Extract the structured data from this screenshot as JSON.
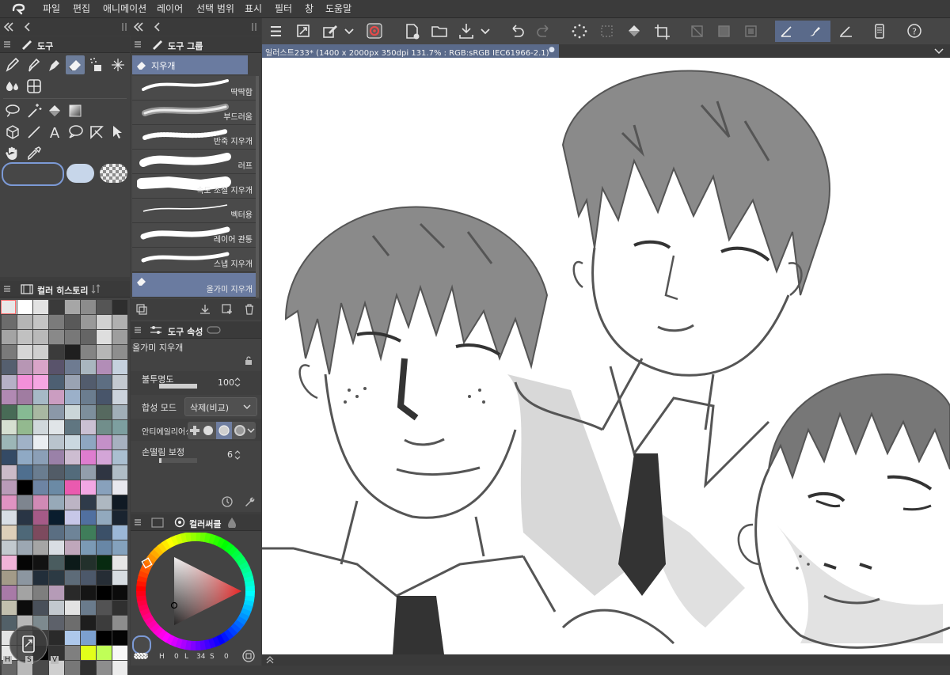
{
  "menubar": {
    "items": [
      "파일",
      "편집",
      "애니메이션",
      "레이어",
      "선택 범위",
      "표시",
      "필터",
      "창",
      "도움말"
    ]
  },
  "canvas_tab": {
    "title": "일러스트233* (1400 x 2000px 350dpi 131.7% : RGB:sRGB IEC61966-2.1)",
    "bullet": "●"
  },
  "tool_panel": {
    "title": "도구"
  },
  "subtool_panel": {
    "title": "도구 그룹",
    "group_name": "지우개",
    "items": [
      "딱딱함",
      "부드러움",
      "반죽 지우개",
      "러프",
      "속도 조절 지우개",
      "벡터용",
      "레이어 관통",
      "스냅 지우개",
      "올가미 지우개"
    ]
  },
  "color_history": {
    "title": "컬러 히스토리"
  },
  "tool_property": {
    "title": "도구 속성",
    "tool_name": "올가미 지우개",
    "opacity_label": "불투명도",
    "opacity_value": "100",
    "opacity_fraction": 1.0,
    "blend_label": "합성 모드",
    "blend_value": "삭제(비교)",
    "aa_label": "안티에일리어싱",
    "stab_label": "손떨림 보정",
    "stab_value": "6",
    "stab_fraction": 0.06
  },
  "color_wheel": {
    "title": "컬러써클",
    "h_label": "H",
    "h_value": "0",
    "l_label": "L",
    "l_value": "34",
    "s_label": "S",
    "s_value": "0"
  },
  "hsv_labels": [
    "H",
    "S",
    "V"
  ],
  "colors": {
    "accent": "#6a7ba0",
    "panel_bg": "#434343",
    "canvas_bg": "#ffffff",
    "line_art": "#555555",
    "hair": "#8a8a8a",
    "shadow": "#d8d8d8"
  },
  "palette": [
    "#e7e7e7",
    "#ffffff",
    "#e2e2e2",
    "#3a3a3a",
    "#a6a6a6",
    "#8c8c8c",
    "#555555",
    "#2e2e2e",
    "#6c6c6c",
    "#b5b5b5",
    "#c4c4c4",
    "#7b7b7b",
    "#595959",
    "#999999",
    "#d1d1d1",
    "#b0b0b0",
    "#a4a4a4",
    "#c1c1c1",
    "#b9b9b9",
    "#898989",
    "#787878",
    "#656565",
    "#dedede",
    "#9e9e9e",
    "#7a7a7a",
    "#d6d6d6",
    "#cfcfcf",
    "#3b3b3b",
    "#1f1f1f",
    "#848484",
    "#b6b6b6",
    "#8e8e8e",
    "#555f6f",
    "#b796b4",
    "#d9a4c8",
    "#59536b",
    "#6e7b91",
    "#a9b6bf",
    "#b28db7",
    "#c5d1de",
    "#b6b0c6",
    "#f390d9",
    "#f6a6e2",
    "#4d5f72",
    "#9aa3b3",
    "#525c6d",
    "#5d6e82",
    "#c3c9d0",
    "#b189b3",
    "#a07ca1",
    "#a6b9c6",
    "#cb9dc1",
    "#9bb0c9",
    "#6b7d8f",
    "#48556a",
    "#cbd3dc",
    "#486b56",
    "#86ba93",
    "#a8b8a2",
    "#8b98a8",
    "#cbd6d8",
    "#7d8f9c",
    "#56695f",
    "#a1afb8",
    "#d5dfd1",
    "#93b98f",
    "#d0d8dc",
    "#e0e5e8",
    "#607681",
    "#cac0d3",
    "#718e8b",
    "#7d9fa0",
    "#9cb6b7",
    "#a0b2c7",
    "#eaeef2",
    "#b9c4cd",
    "#cad8e0",
    "#8ea6c1",
    "#c490c8",
    "#a7b1c0",
    "#344a65",
    "#8fa9c4",
    "#8b9fb7",
    "#9a81a8",
    "#cdbdd1",
    "#de7dcf",
    "#d3a5d7",
    "#aabfd0",
    "#cbbbc8",
    "#4f6f8f",
    "#6a7d90",
    "#525c67",
    "#536b7b",
    "#929eab",
    "#2f3542",
    "#b0bdc6",
    "#b99bb8",
    "#000000",
    "#6d84a4",
    "#6b8aa5",
    "#ea5aaf",
    "#f2a7e4",
    "#88a1bc",
    "#e8e8ee",
    "#e093c2",
    "#7e858f",
    "#d08ab5",
    "#97a9b8",
    "#bcb4c4",
    "#2f3b4a",
    "#aeb8c1",
    "#101a24",
    "#d8dee5",
    "#293545",
    "#a55a87",
    "#0a1d2e",
    "#c7c7e8",
    "#5170a0",
    "#92a9be",
    "#1a2430",
    "#ddcfb9",
    "#4e6878",
    "#7d4a5e",
    "#5a6e82",
    "#6e8498",
    "#3f7d5a",
    "#3b5068",
    "#9bb7d7",
    "#c2c9ce",
    "#9ca7b2",
    "#a5a5a5",
    "#d9dde3",
    "#bfa7bb",
    "#7b9ab5",
    "#6887a6",
    "#84a2bd",
    "#f0b3d8",
    "#050505",
    "#121212",
    "#4a5c5f",
    "#0c1a19",
    "#22302b",
    "#072a10",
    "#e6e6e6",
    "#a39b88",
    "#8c96a0",
    "#222e3a",
    "#2c3a44",
    "#5d6b78",
    "#4c586a",
    "#262d35",
    "#d7dde2",
    "#a87aa7",
    "#a3a3a3",
    "#7e7e7e",
    "#b59bb7",
    "#292929",
    "#151515",
    "#000000",
    "#0b0b0b",
    "#c2bfae",
    "#0c0c0c",
    "#49505a",
    "#c2c8ce",
    "#e3e3e3",
    "#6a7b8c",
    "#525253",
    "#303030",
    "#526068",
    "#b7b7b7",
    "#7d8a8f",
    "#5d616a",
    "#6d6d6d",
    "#1e1e1e",
    "#3c3c3c",
    "#8d8d8d",
    "#e3e3e3",
    "#c2c2c2",
    "#3d3d3d",
    "#2a2a2a",
    "#adc8eb",
    "#7ca0cf",
    "#000000",
    "#050505",
    "#e7e7e7",
    "#c6c6c6",
    "#000000",
    "#333333",
    "#7f7f7f",
    "#e2ff1a",
    "#c0ff57",
    "#f8f8f8",
    "#666666",
    "#b9b9b9",
    "#4a4a4a",
    "#cfcfcf",
    "#777777",
    "#303030",
    "#8d8d8d",
    "#ececec"
  ]
}
